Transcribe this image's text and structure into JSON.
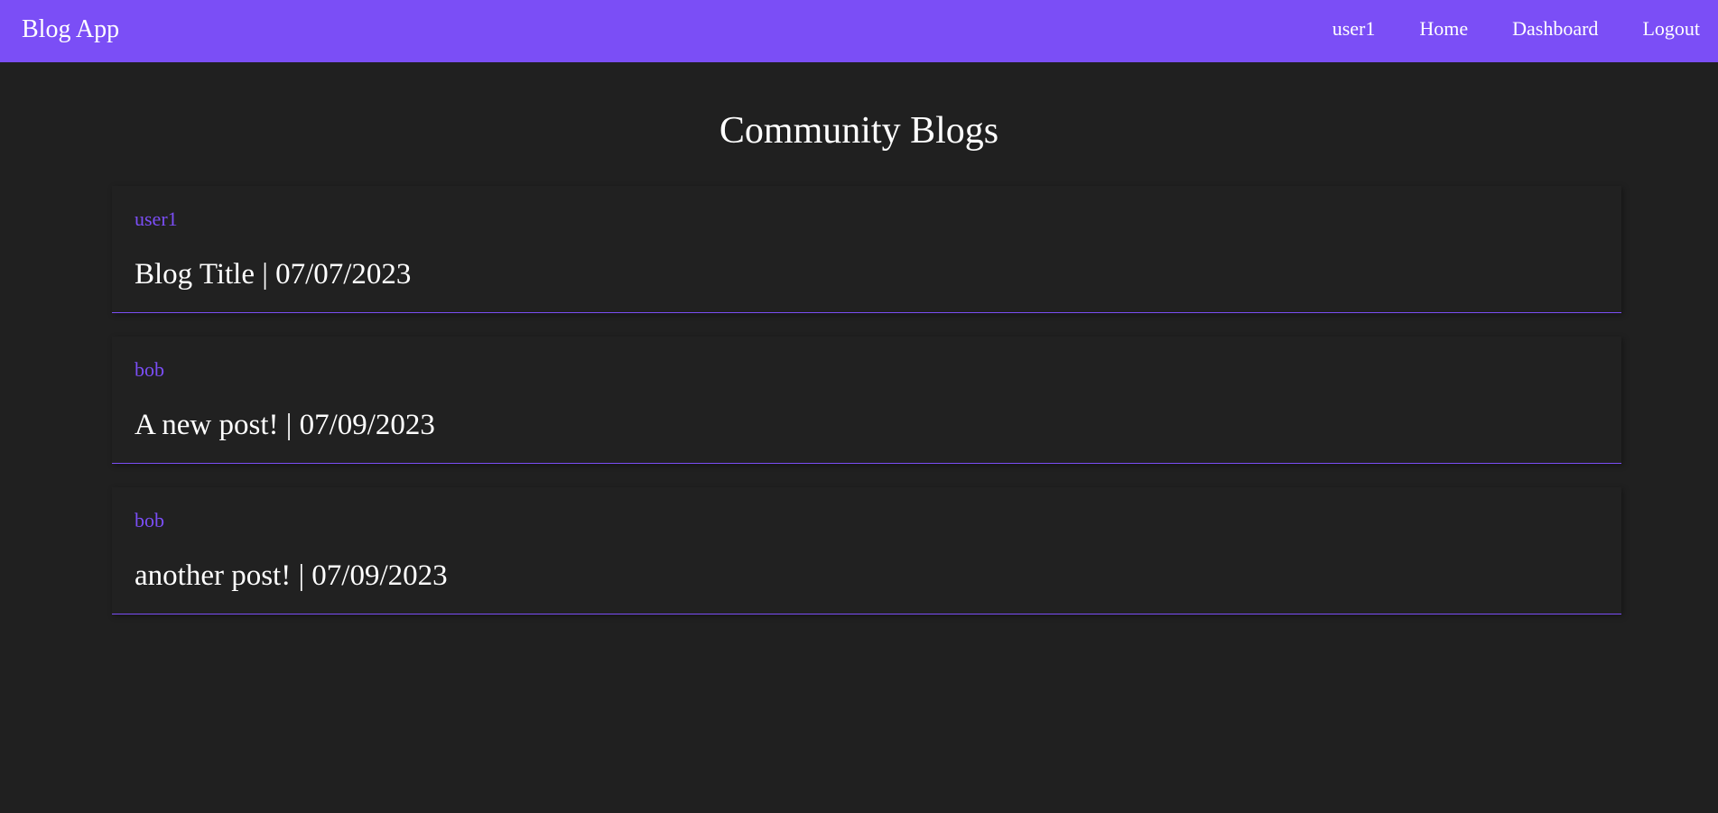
{
  "app": {
    "brand": "Blog App"
  },
  "nav": {
    "items": [
      {
        "label": "user1"
      },
      {
        "label": "Home"
      },
      {
        "label": "Dashboard"
      },
      {
        "label": "Logout"
      }
    ]
  },
  "page": {
    "title": "Community Blogs"
  },
  "posts": [
    {
      "author": "user1",
      "title_line": "Blog Title | 07/07/2023"
    },
    {
      "author": "bob",
      "title_line": "A new post! | 07/09/2023"
    },
    {
      "author": "bob",
      "title_line": "another post! | 07/09/2023"
    }
  ],
  "colors": {
    "accent": "#7b4ef6",
    "background": "#202020",
    "card": "#212121",
    "text": "#ffffff"
  }
}
